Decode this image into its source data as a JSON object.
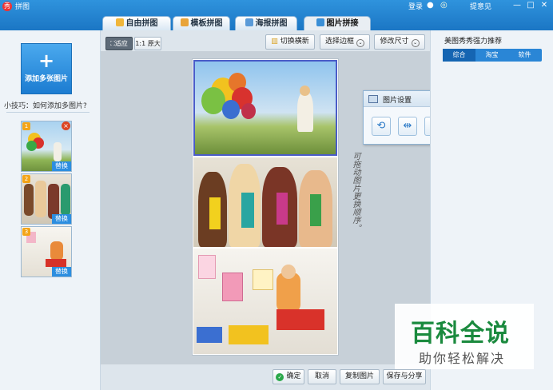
{
  "window": {
    "title": "拼图",
    "login": "登录",
    "feedback": "提意见",
    "controls": [
      "—",
      "□",
      "✕"
    ]
  },
  "tabs": [
    {
      "label": "自由拼图",
      "active": false
    },
    {
      "label": "模板拼图",
      "active": false
    },
    {
      "label": "海报拼图",
      "active": false
    },
    {
      "label": "图片拼接",
      "active": true
    }
  ],
  "left": {
    "add_label": "添加多张图片",
    "tip": "小技巧：如何添加多图片?",
    "thumbs": [
      {
        "num": "1",
        "replace": "替换"
      },
      {
        "num": "2",
        "replace": "替换"
      },
      {
        "num": "3",
        "replace": "替换"
      }
    ]
  },
  "toolbar": {
    "fit": "适应",
    "original": "1:1 原大",
    "switch": "切换横新",
    "border": "选择边框",
    "resize": "修改尺寸"
  },
  "side_note": "可拖动图片更换顺序。",
  "popup": {
    "title": "图片设置",
    "buttons": [
      "rotate-icon",
      "flip-icon",
      "crop-icon",
      "delete-icon"
    ]
  },
  "right": {
    "title": "美图秀秀强力推荐",
    "tabs": [
      {
        "label": "综合",
        "active": true
      },
      {
        "label": "淘宝",
        "active": false
      },
      {
        "label": "软件",
        "active": false
      }
    ]
  },
  "bottom": {
    "ok": "确定",
    "cancel": "取消",
    "copy": "复制图片",
    "save": "保存与分享"
  },
  "watermark": {
    "big": "百科全说",
    "small": "助你轻松解决"
  }
}
